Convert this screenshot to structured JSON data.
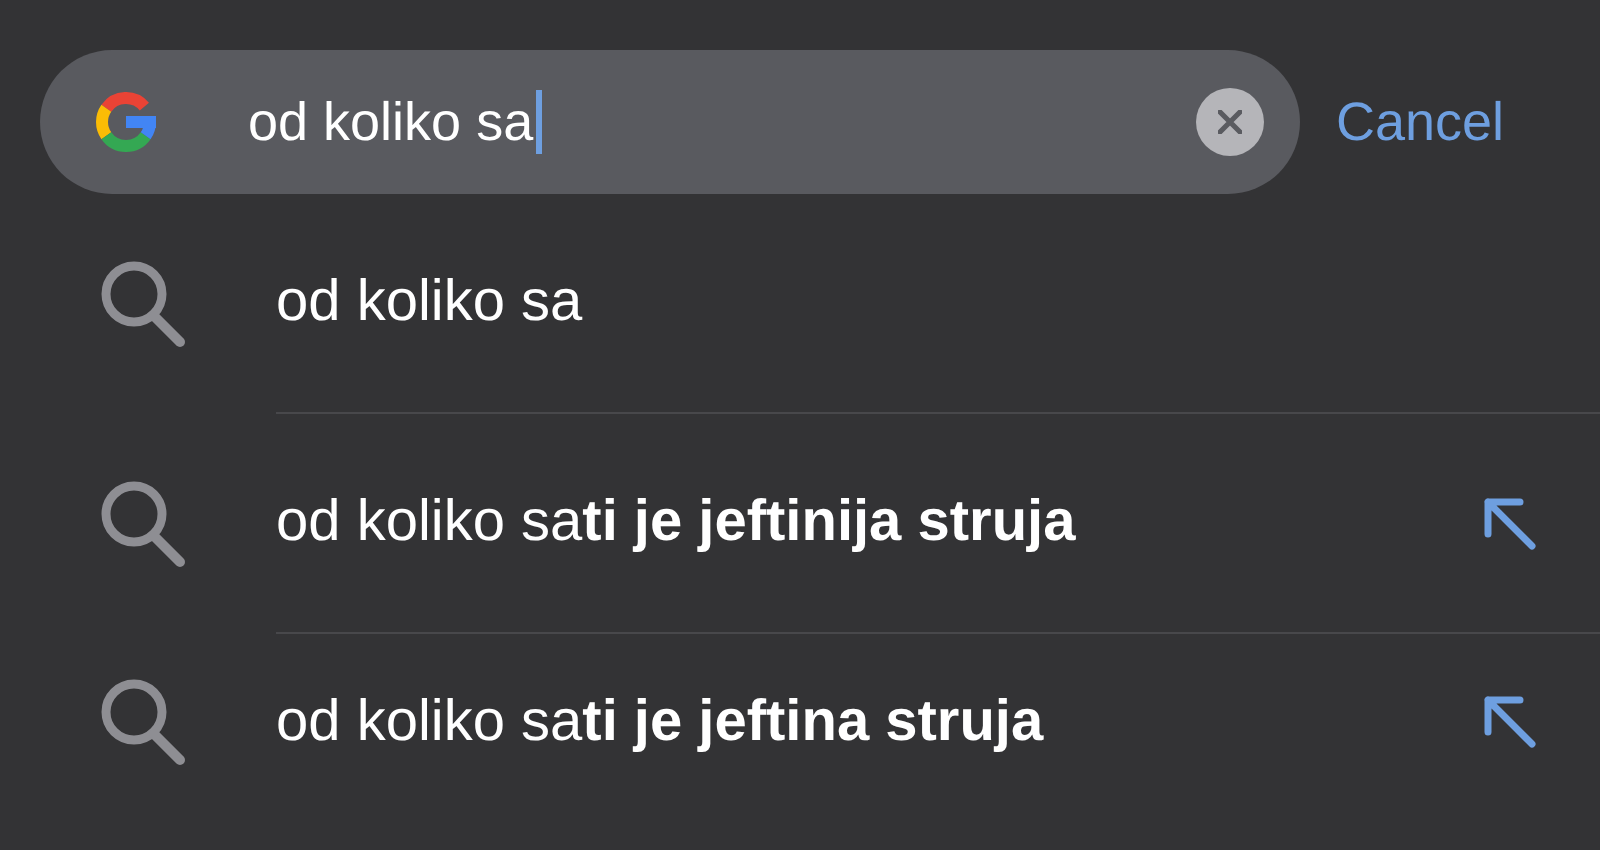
{
  "search": {
    "value": "od koliko sa"
  },
  "cancel": "Cancel",
  "suggestions": [
    {
      "kind": "typed",
      "text": "od koliko sa"
    },
    {
      "kind": "suggestion",
      "text": "od koliko sa**ti je jeftinija struja**"
    },
    {
      "kind": "suggestion",
      "text": "od koliko sa**ti je jeftina struja**"
    }
  ]
}
